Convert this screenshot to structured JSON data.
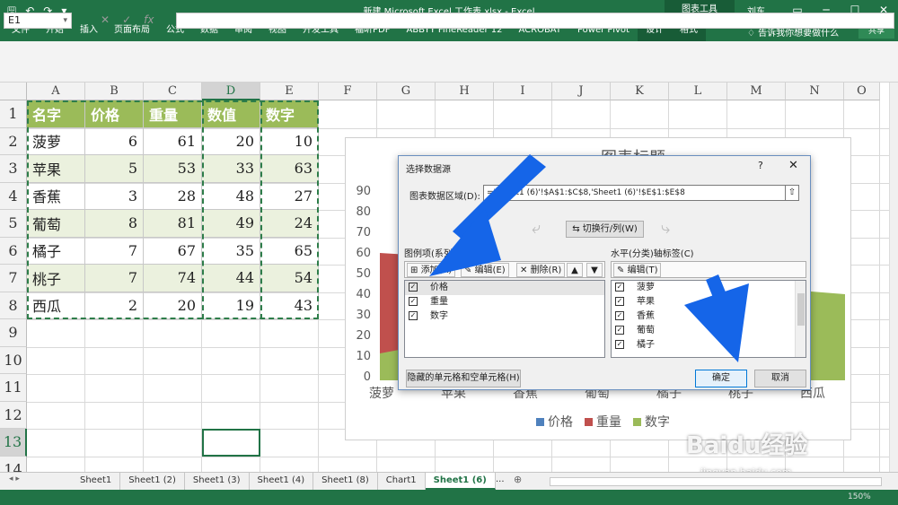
{
  "window": {
    "title": "新建 Microsoft Excel 工作表.xlsx - Excel",
    "context_tool": "图表工具",
    "user": "刘东"
  },
  "quick_access": [
    "save-icon",
    "undo-icon",
    "redo-icon",
    "customize-icon"
  ],
  "ribbon": {
    "tabs": [
      "文件",
      "开始",
      "插入",
      "页面布局",
      "公式",
      "数据",
      "审阅",
      "视图",
      "开发工具",
      "福昕PDF",
      "ABBYY FineReader 12",
      "ACROBAT",
      "Power Pivot",
      "设计",
      "格式"
    ],
    "tell_me": "告诉我你想要做什么",
    "share": "共享"
  },
  "formula_bar": {
    "name_box": "E1",
    "formula": ""
  },
  "grid": {
    "columns": [
      "A",
      "B",
      "C",
      "D",
      "E",
      "F",
      "G",
      "H",
      "I",
      "J",
      "K",
      "L",
      "M",
      "N",
      "O"
    ],
    "rows": [
      "1",
      "2",
      "3",
      "4",
      "5",
      "6",
      "7",
      "8",
      "9",
      "10",
      "11",
      "12",
      "13",
      "14"
    ],
    "selected_column": "D",
    "selected_row": "13"
  },
  "table": {
    "headers": [
      "名字",
      "价格",
      "重量",
      "数值",
      "数字"
    ],
    "rows": [
      [
        "菠萝",
        "6",
        "61",
        "20",
        "10"
      ],
      [
        "苹果",
        "5",
        "53",
        "33",
        "63"
      ],
      [
        "香蕉",
        "3",
        "28",
        "48",
        "27"
      ],
      [
        "葡萄",
        "8",
        "81",
        "49",
        "24"
      ],
      [
        "橘子",
        "7",
        "67",
        "35",
        "65"
      ],
      [
        "桃子",
        "7",
        "74",
        "44",
        "54"
      ],
      [
        "西瓜",
        "2",
        "20",
        "19",
        "43"
      ]
    ],
    "colors": {
      "header": "#9bbb59",
      "band": "#ebf1de"
    }
  },
  "chart": {
    "title": "图表标题",
    "y_ticks": [
      "90",
      "80",
      "70",
      "60",
      "50",
      "40",
      "30",
      "20",
      "10",
      "0"
    ],
    "x_ticks": [
      "菠萝",
      "苹果",
      "香蕉",
      "葡萄",
      "橘子",
      "桃子",
      "西瓜"
    ],
    "legend": [
      {
        "label": "价格",
        "color": "#4f81bd"
      },
      {
        "label": "重量",
        "color": "#c0504d"
      },
      {
        "label": "数字",
        "color": "#9bbb59"
      }
    ]
  },
  "dialog": {
    "title": "选择数据源",
    "help": "?",
    "close": "✕",
    "range_label": "图表数据区域(D):",
    "range_value": "='Sheet1 (6)'!$A$1:$C$8,'Sheet1 (6)'!$E$1:$E$8",
    "switch_label": "切换行/列(W)",
    "legend_label": "图例项(系列)(S)",
    "legend_buttons": {
      "add": "添加(A)",
      "edit": "编辑(E)",
      "delete": "删除(R)"
    },
    "series": [
      "价格",
      "重量",
      "数字"
    ],
    "axis_label": "水平(分类)轴标签(C)",
    "axis_edit": "编辑(T)",
    "categories": [
      "菠萝",
      "苹果",
      "香蕉",
      "葡萄",
      "橘子"
    ],
    "hidden_button": "隐藏的单元格和空单元格(H)",
    "ok": "确定",
    "cancel": "取消"
  },
  "sheets": {
    "tabs": [
      "Sheet1",
      "Sheet1 (2)",
      "Sheet1 (3)",
      "Sheet1 (4)",
      "Sheet1 (8)",
      "Chart1",
      "Sheet1 (6)"
    ],
    "active_index": 6,
    "more": "..."
  },
  "status": {
    "zoom": "150%"
  },
  "watermark": {
    "logo": "Baidu经验",
    "url": "jingyan.baidu.com"
  },
  "colors": {
    "excel_green": "#217346",
    "arrow_blue": "#1565e8"
  }
}
